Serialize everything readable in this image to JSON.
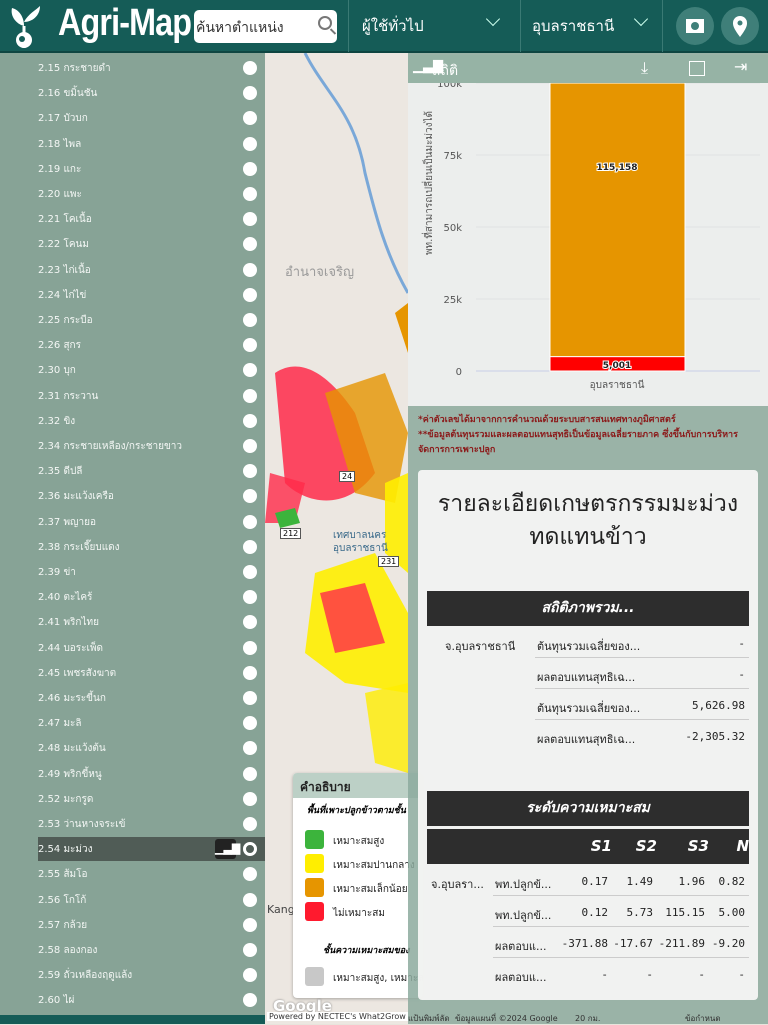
{
  "header": {
    "app_title": "Agri-Map",
    "search_placeholder": "ค้นหาตำแหน่ง",
    "user_dropdown": "ผู้ใช้ทั่วไป",
    "province_dropdown": "อุบลราชธานี"
  },
  "sidebar": {
    "items": [
      {
        "label": "2.15 กระชายดำ"
      },
      {
        "label": "2.16 ขมิ้นชัน"
      },
      {
        "label": "2.17 บัวบก"
      },
      {
        "label": "2.18 ไพล"
      },
      {
        "label": "2.19 แกะ"
      },
      {
        "label": "2.20 แพะ"
      },
      {
        "label": "2.21 โคเนื้อ"
      },
      {
        "label": "2.22 โคนม"
      },
      {
        "label": "2.23 ไก่เนื้อ"
      },
      {
        "label": "2.24 ไก่ไข่"
      },
      {
        "label": "2.25 กระบือ"
      },
      {
        "label": "2.26 สุกร"
      },
      {
        "label": "2.30 บุก"
      },
      {
        "label": "2.31 กระวาน"
      },
      {
        "label": "2.32 ขิง"
      },
      {
        "label": "2.34 กระชายเหลือง/กระชายขาว"
      },
      {
        "label": "2.35 ดีปลี"
      },
      {
        "label": "2.36 มะแว้งเครือ"
      },
      {
        "label": "2.37 พญายอ"
      },
      {
        "label": "2.38 กระเจี๊ยบแดง"
      },
      {
        "label": "2.39 ข่า"
      },
      {
        "label": "2.40 ตะไคร้"
      },
      {
        "label": "2.41 พริกไทย"
      },
      {
        "label": "2.44 บอระเพ็ด"
      },
      {
        "label": "2.45 เพชรสังฆาต"
      },
      {
        "label": "2.46 มะระขี้นก"
      },
      {
        "label": "2.47 มะลิ"
      },
      {
        "label": "2.48 มะแว้งต้น"
      },
      {
        "label": "2.49 พริกขี้หนู"
      },
      {
        "label": "2.52 มะกรูด"
      },
      {
        "label": "2.53 ว่านหางจระเข้"
      },
      {
        "label": "2.54 มะม่วง",
        "selected": true
      },
      {
        "label": "2.55 ส้มโอ"
      },
      {
        "label": "2.56 โกโก้"
      },
      {
        "label": "2.57 กล้วย"
      },
      {
        "label": "2.58 ลองกอง"
      },
      {
        "label": "2.59 ถั่วเหลืองฤดูแล้ง"
      },
      {
        "label": "2.60 ไผ่"
      }
    ]
  },
  "stats": {
    "title": "สถิติ",
    "notes": [
      "*ค่าตัวเลขได้มาจากการคำนวณด้วยระบบสารสนเทศทางภูมิศาสตร์",
      "**ข้อมูลต้นทุนรวมและผลตอบแทนสุทธิเป็นข้อมูลเฉลี่ยรายภาค ซึ่งขึ้นกับการบริหารจัดการการเพาะปลูก"
    ]
  },
  "chart_data": {
    "type": "bar",
    "stacked": true,
    "categories": [
      "อุบลราชธานี"
    ],
    "series": [
      {
        "name": "ไม่เหมาะสม",
        "values": [
          5001
        ],
        "color": "#ff0000",
        "label": "5,001"
      },
      {
        "name": "เหมาะสมเล็กน้อย",
        "values": [
          115158
        ],
        "color": "#e69500",
        "label": "115,158"
      }
    ],
    "ylabel": "พท.ที่สามารถเปลี่ยนเป็นมะม่วงได้",
    "yticks": [
      "0",
      "25k",
      "50k",
      "75k",
      "100k"
    ],
    "ylim": [
      0,
      100000
    ]
  },
  "details": {
    "title_line1": "รายละเอียดเกษตรกรรมมะม่วง",
    "title_line2": "ทดแทนข้าว",
    "overview_header": "สถิติภาพรวม...",
    "overview_rows": [
      {
        "region": "จ.อุบลราชธานี",
        "metric": "ต้นทุนรวมเฉลี่ยของ...",
        "value": "-"
      },
      {
        "region": "",
        "metric": "ผลตอบแทนสุทธิเฉ...",
        "value": "-"
      },
      {
        "region": "",
        "metric": "ต้นทุนรวมเฉลี่ยของ...",
        "value": "5,626.98"
      },
      {
        "region": "",
        "metric": "ผลตอบแทนสุทธิเฉ...",
        "value": "-2,305.32"
      }
    ],
    "suit_header": "ระดับความเหมาะสม",
    "suit_cols": [
      "S1",
      "S2",
      "S3",
      "N"
    ],
    "suit_rows": [
      {
        "region": "จ.อุบลรา...",
        "metric": "พท.ปลูกข้...",
        "v": [
          "0.17",
          "1.49",
          "1.96",
          "0.82"
        ]
      },
      {
        "region": "",
        "metric": "พท.ปลูกข้...",
        "v": [
          "0.12",
          "5.73",
          "115.15",
          "5.00"
        ]
      },
      {
        "region": "",
        "metric": "ผลตอบแ...",
        "v": [
          "-371.88",
          "-17.67",
          "-211.89",
          "-9.20"
        ]
      },
      {
        "region": "",
        "metric": "ผลตอบแ...",
        "v": [
          "-",
          "-",
          "-",
          "-"
        ]
      }
    ]
  },
  "legend": {
    "title": "คำอธิบาย",
    "section1": "พื้นที่เพาะปลูกข้าวตามชั้น",
    "items": [
      {
        "label": "เหมาะสมสูง",
        "color": "#3cb43c"
      },
      {
        "label": "เหมาะสมปานกลาง",
        "color": "#ffee00"
      },
      {
        "label": "เหมาะสมเล็กน้อย",
        "color": "#e69500"
      },
      {
        "label": "ไม่เหมาะสม",
        "color": "#ff1a2e"
      }
    ],
    "section2": "ชั้นความเหมาะสมของ",
    "item2": {
      "label": "เหมาะสมสูง, เหมาะสม",
      "color": "#c8c8c8"
    }
  },
  "map": {
    "labels": [
      "อำนาจเจริญ",
      "เทศบาลนคร อุบลราชธานี",
      "Kang",
      "Google"
    ],
    "route_badges": [
      "212",
      "231",
      "24"
    ]
  },
  "footer": {
    "powered": "Powered by NECTEC's What2Grow",
    "shortcuts": "แป้นพิมพ์ลัด",
    "mapdata": "ข้อมูลแผนที่ ©2024 Google",
    "scale": "20 กม.",
    "terms": "ข้อกำหนด"
  }
}
